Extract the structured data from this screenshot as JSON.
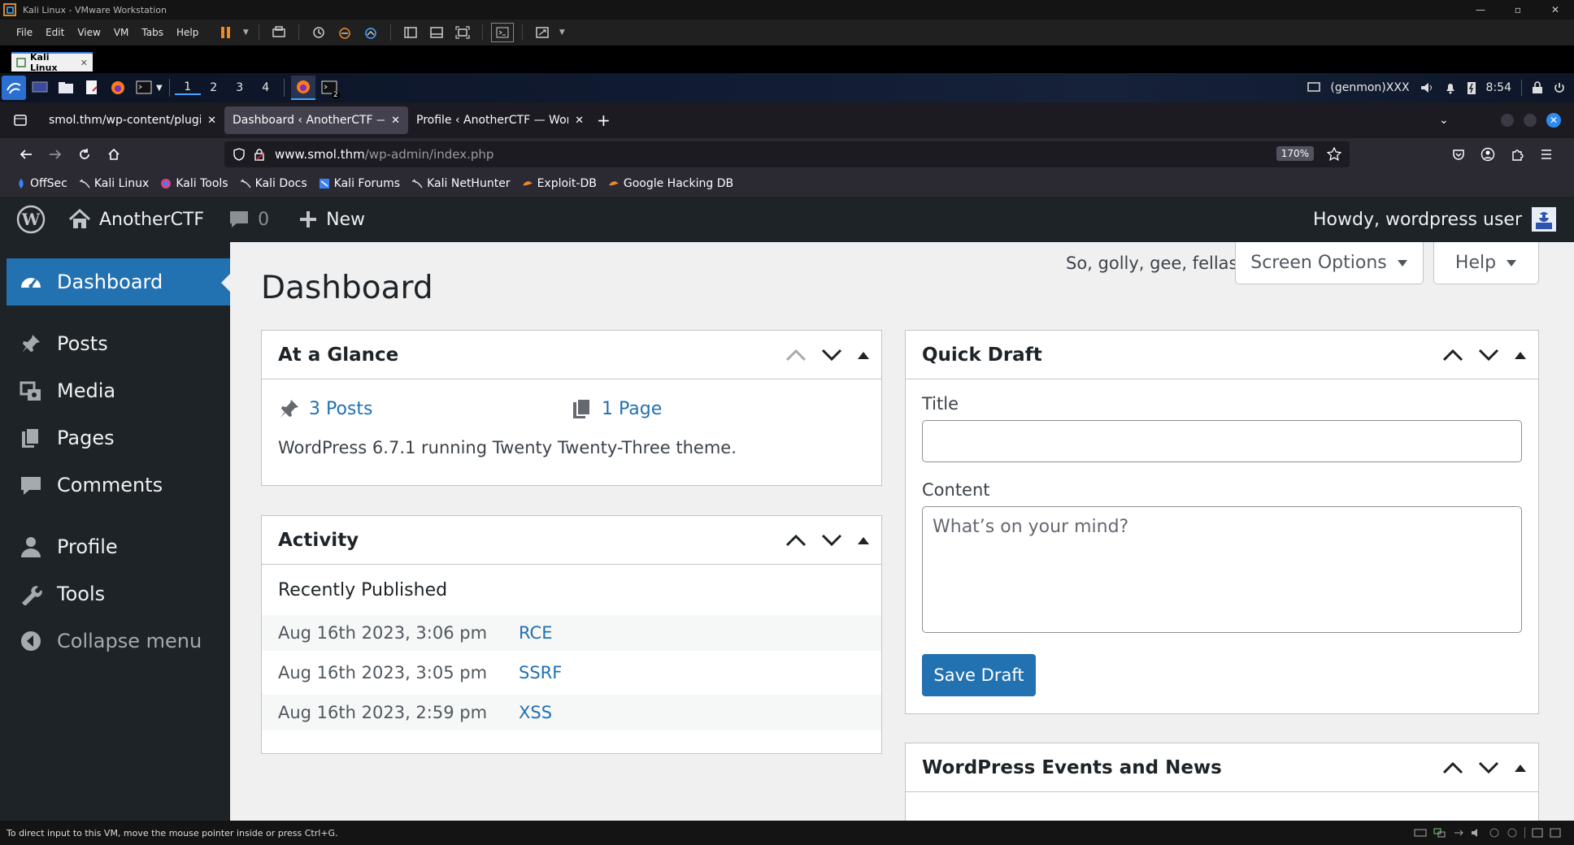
{
  "vmware": {
    "title": "Kali Linux - VMware Workstation",
    "menu": [
      "File",
      "Edit",
      "View",
      "VM",
      "Tabs",
      "Help"
    ],
    "tab_label": "Kali Linux",
    "status_text": "To direct input to this VM, move the mouse pointer inside or press Ctrl+G."
  },
  "kali": {
    "workspaces": [
      "1",
      "2",
      "3",
      "4"
    ],
    "genmon": "(genmon)XXX",
    "clock": "8:54",
    "terminal_badge": "2"
  },
  "browser": {
    "tabs": [
      {
        "label": "smol.thm/wp-content/plugin",
        "active": false
      },
      {
        "label": "Dashboard ‹ AnotherCTF — W",
        "active": true
      },
      {
        "label": "Profile ‹ AnotherCTF — Word",
        "active": false
      }
    ],
    "url_host": "www.smol.thm",
    "url_path": "/wp-admin/index.php",
    "zoom": "170%",
    "bookmarks": [
      "OffSec",
      "Kali Linux",
      "Kali Tools",
      "Kali Docs",
      "Kali Forums",
      "Kali NetHunter",
      "Exploit-DB",
      "Google Hacking DB"
    ]
  },
  "wp": {
    "site_name": "AnotherCTF",
    "comments_count": "0",
    "new_label": "New",
    "howdy": "Howdy, wordpress user",
    "menu": [
      "Dashboard",
      "Posts",
      "Media",
      "Pages",
      "Comments",
      "Profile",
      "Tools",
      "Collapse menu"
    ],
    "hello_dolly": "So, golly, gee, fellas",
    "screen_options": "Screen Options",
    "help": "Help",
    "page_title": "Dashboard",
    "glance": {
      "title": "At a Glance",
      "posts": "3 Posts",
      "pages": "1 Page",
      "version_text": "WordPress 6.7.1 running Twenty Twenty-Three theme."
    },
    "activity": {
      "title": "Activity",
      "subtitle": "Recently Published",
      "rows": [
        {
          "date": "Aug 16th 2023, 3:06 pm",
          "title": "RCE"
        },
        {
          "date": "Aug 16th 2023, 3:05 pm",
          "title": "SSRF"
        },
        {
          "date": "Aug 16th 2023, 2:59 pm",
          "title": "XSS"
        }
      ]
    },
    "quick_draft": {
      "title": "Quick Draft",
      "title_label": "Title",
      "content_label": "Content",
      "content_placeholder": "What’s on your mind?",
      "save_label": "Save Draft"
    },
    "events": {
      "title": "WordPress Events and News"
    }
  },
  "colors": {
    "wp_admin_dark": "#1d2327",
    "wp_blue": "#2271b1",
    "ff_dark": "#1c1b22",
    "ff_toolbar": "#2b2a33"
  }
}
